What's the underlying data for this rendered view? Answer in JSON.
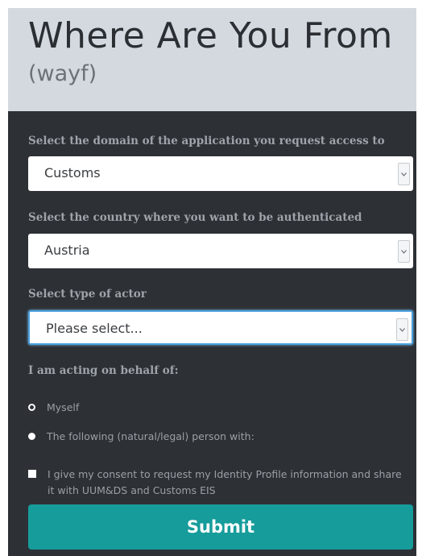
{
  "header": {
    "title": "Where Are You From",
    "subtitle": "(wayf)"
  },
  "form": {
    "domain_label": "Select the domain of the application you request access to",
    "domain_value": "Customs",
    "country_label": "Select the country where you want to be authenticated",
    "country_value": "Austria",
    "actor_label": "Select type of actor",
    "actor_value": "Please select...",
    "behalf_label": "I am acting on behalf of:",
    "behalf_options": [
      "Myself",
      "The following (natural/legal) person with:"
    ],
    "consent_text": "I give my consent to request my Identity Profile information and share it with UUM&DS and Customs EIS",
    "submit_label": "Submit"
  },
  "colors": {
    "header_bg": "#d3d9df",
    "panel_bg": "#2d3035",
    "submit_bg": "#169c9b",
    "focus": "#4aa0df"
  },
  "icons": {
    "select_arrow": "chevron-down-icon"
  }
}
